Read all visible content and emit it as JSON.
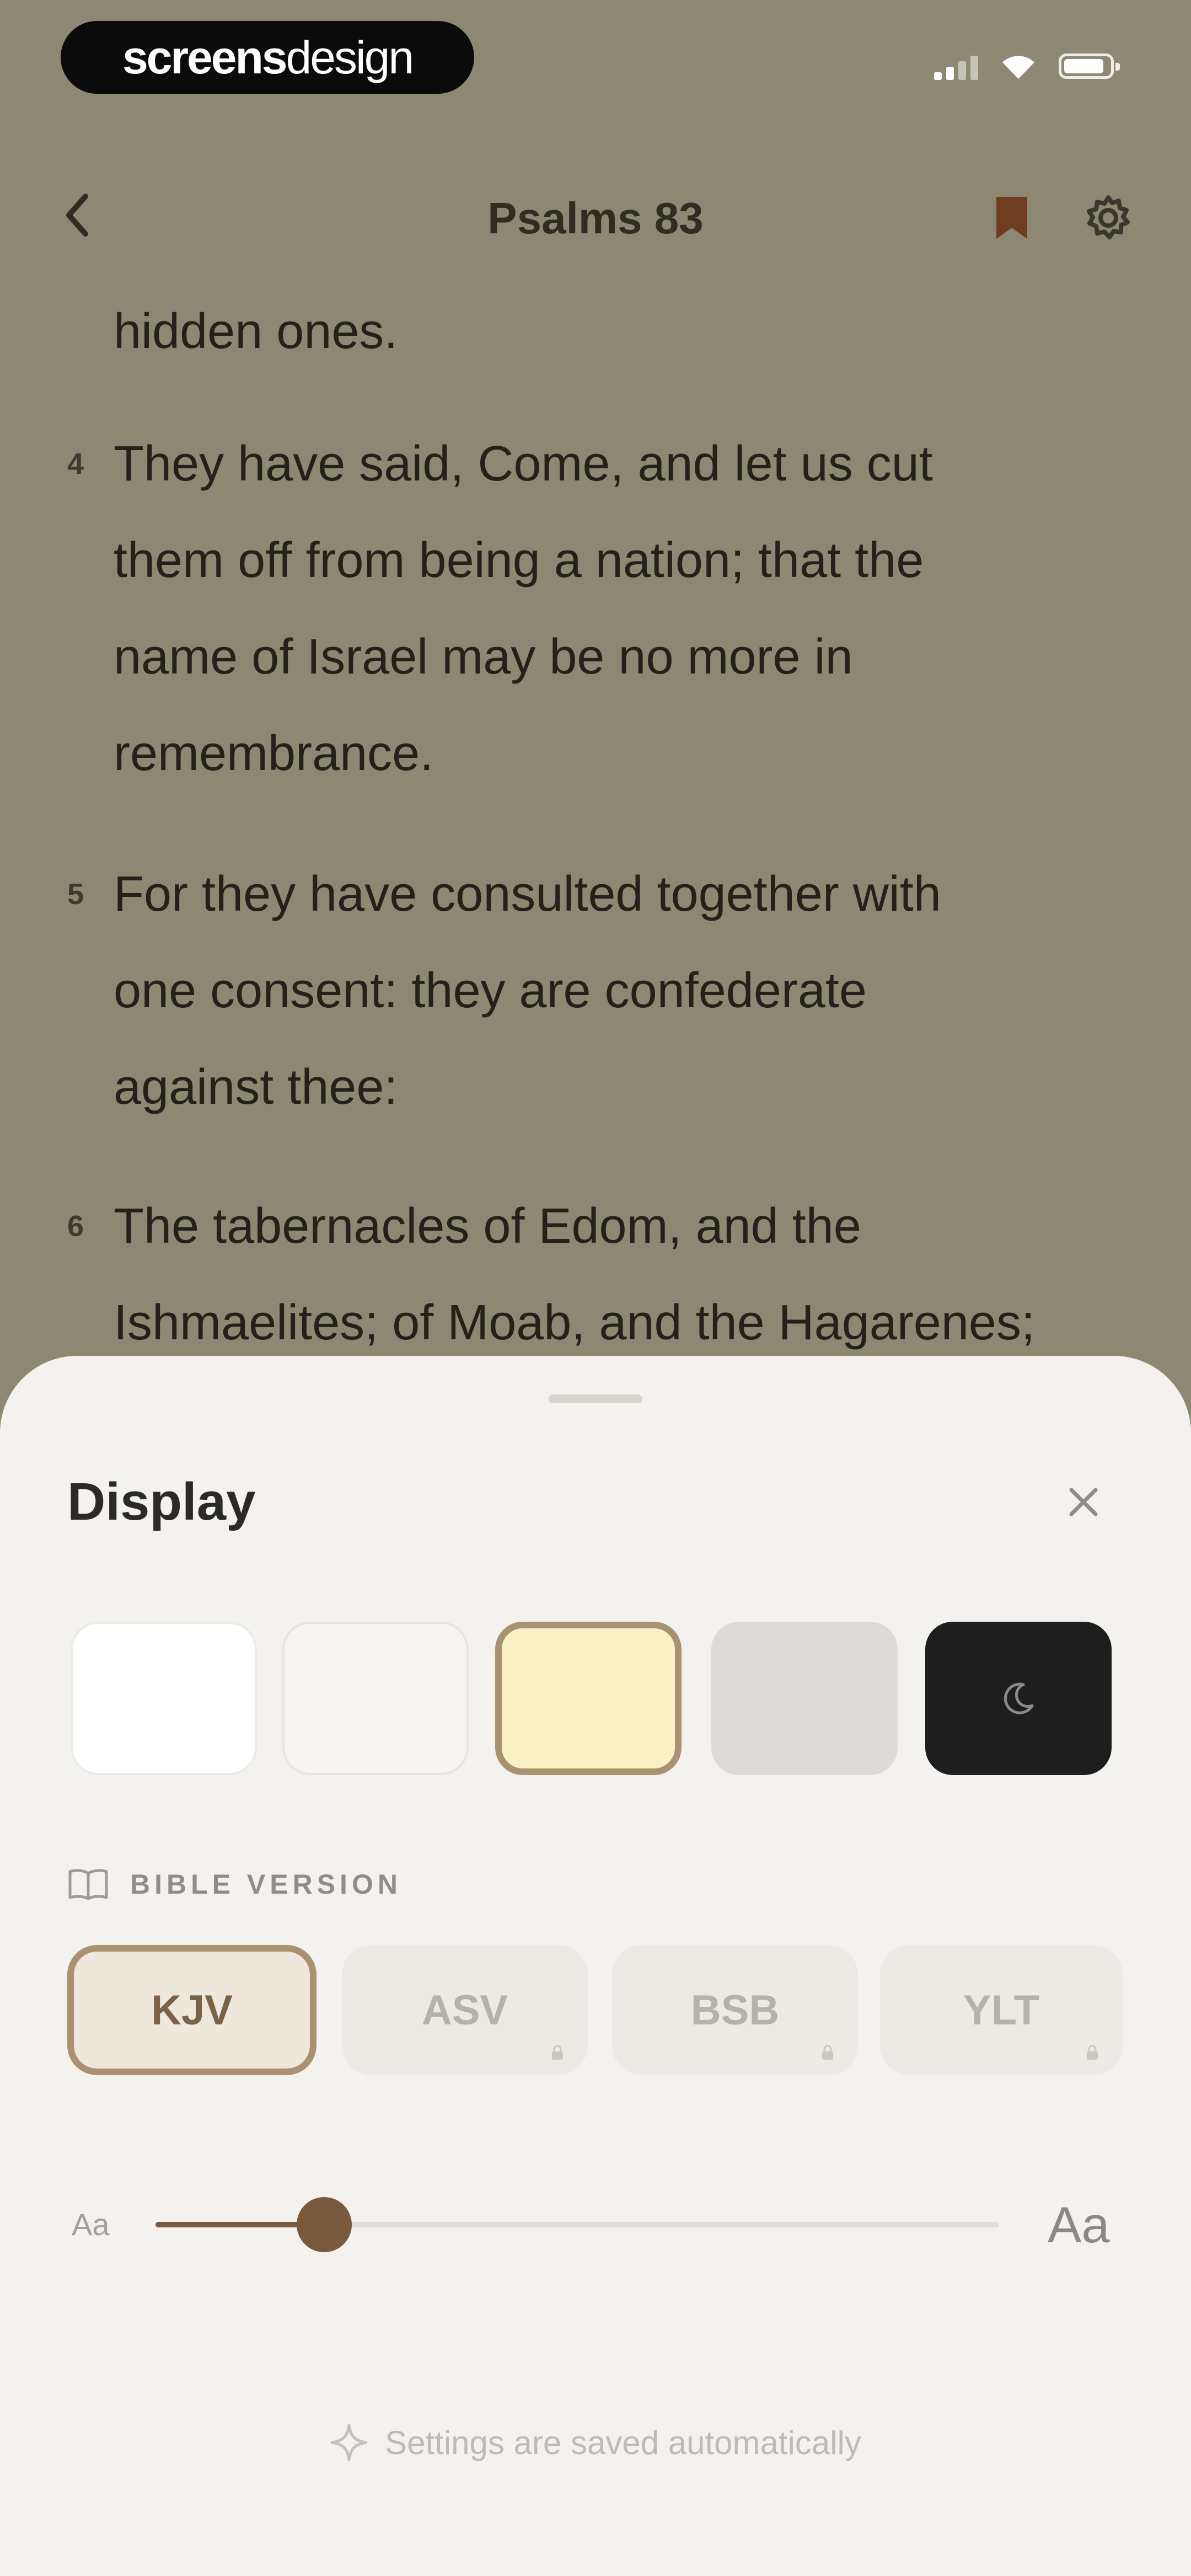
{
  "brand": {
    "bold": "screens",
    "light": "design"
  },
  "nav": {
    "title": "Psalms 83"
  },
  "scripture": {
    "lines": [
      {
        "num": "",
        "text": "hidden ones."
      },
      {
        "num": "4",
        "text": "They have said, Come, and let us cut"
      },
      {
        "num": "",
        "text": "them off from being a nation; that the"
      },
      {
        "num": "",
        "text": "name of Israel may be no more in"
      },
      {
        "num": "",
        "text": "remembrance."
      },
      {
        "num": "5",
        "text": "For they have consulted together with"
      },
      {
        "num": "",
        "text": "one consent: they are confederate"
      },
      {
        "num": "",
        "text": "against thee:"
      },
      {
        "num": "6",
        "text": "The tabernacles of Edom, and the"
      },
      {
        "num": "",
        "text": "Ishmaelites; of Moab, and the Hagarenes;"
      }
    ]
  },
  "display_sheet": {
    "title": "Display",
    "themes": [
      {
        "name": "white",
        "color": "#ffffff"
      },
      {
        "name": "off-white",
        "color": "#f5f4f0"
      },
      {
        "name": "sepia",
        "color": "#fbefc4",
        "selected": true
      },
      {
        "name": "gray",
        "color": "#dcdbd8"
      },
      {
        "name": "dark",
        "color": "#1e1e1e",
        "icon": "moon-icon"
      }
    ],
    "version_label": "BIBLE VERSION",
    "versions": [
      {
        "label": "KJV",
        "selected": true,
        "locked": false
      },
      {
        "label": "ASV",
        "selected": false,
        "locked": true
      },
      {
        "label": "BSB",
        "selected": false,
        "locked": true
      },
      {
        "label": "YLT",
        "selected": false,
        "locked": true
      }
    ],
    "font_size": {
      "small_label": "Aa",
      "large_label": "Aa",
      "value_fraction": 0.2
    },
    "footer": "Settings are saved automatically"
  },
  "colors": {
    "accent": "#7a5a3e",
    "selected_border": "#a99270",
    "reader_bg": "#8c8872",
    "sheet_bg": "#f3f2ee"
  }
}
